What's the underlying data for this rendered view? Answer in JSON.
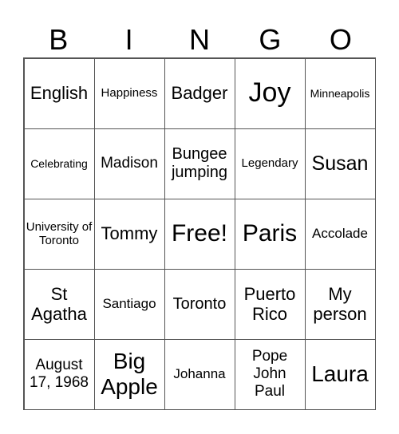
{
  "header": [
    "B",
    "I",
    "N",
    "G",
    "O"
  ],
  "cells": [
    {
      "text": "English",
      "size": "s22"
    },
    {
      "text": "Happiness",
      "size": "s15"
    },
    {
      "text": "Badger",
      "size": "s22"
    },
    {
      "text": "Joy",
      "size": "s34"
    },
    {
      "text": "Minneapolis",
      "size": "s14"
    },
    {
      "text": "Celebrating",
      "size": "s14"
    },
    {
      "text": "Madison",
      "size": "s19"
    },
    {
      "text": "Bungee jumping",
      "size": "s20"
    },
    {
      "text": "Legendary",
      "size": "s15"
    },
    {
      "text": "Susan",
      "size": "s25"
    },
    {
      "text": "University of Toronto",
      "size": "s15"
    },
    {
      "text": "Tommy",
      "size": "s22"
    },
    {
      "text": "Free!",
      "size": "s30"
    },
    {
      "text": "Paris",
      "size": "s30"
    },
    {
      "text": "Accolade",
      "size": "s17"
    },
    {
      "text": "St Agatha",
      "size": "s22"
    },
    {
      "text": "Santiago",
      "size": "s17"
    },
    {
      "text": "Toronto",
      "size": "s20"
    },
    {
      "text": "Puerto Rico",
      "size": "s22"
    },
    {
      "text": "My person",
      "size": "s22"
    },
    {
      "text": "August 17, 1968",
      "size": "s19"
    },
    {
      "text": "Big Apple",
      "size": "s28"
    },
    {
      "text": "Johanna",
      "size": "s17"
    },
    {
      "text": "Pope John Paul",
      "size": "s19"
    },
    {
      "text": "Laura",
      "size": "s28"
    }
  ]
}
